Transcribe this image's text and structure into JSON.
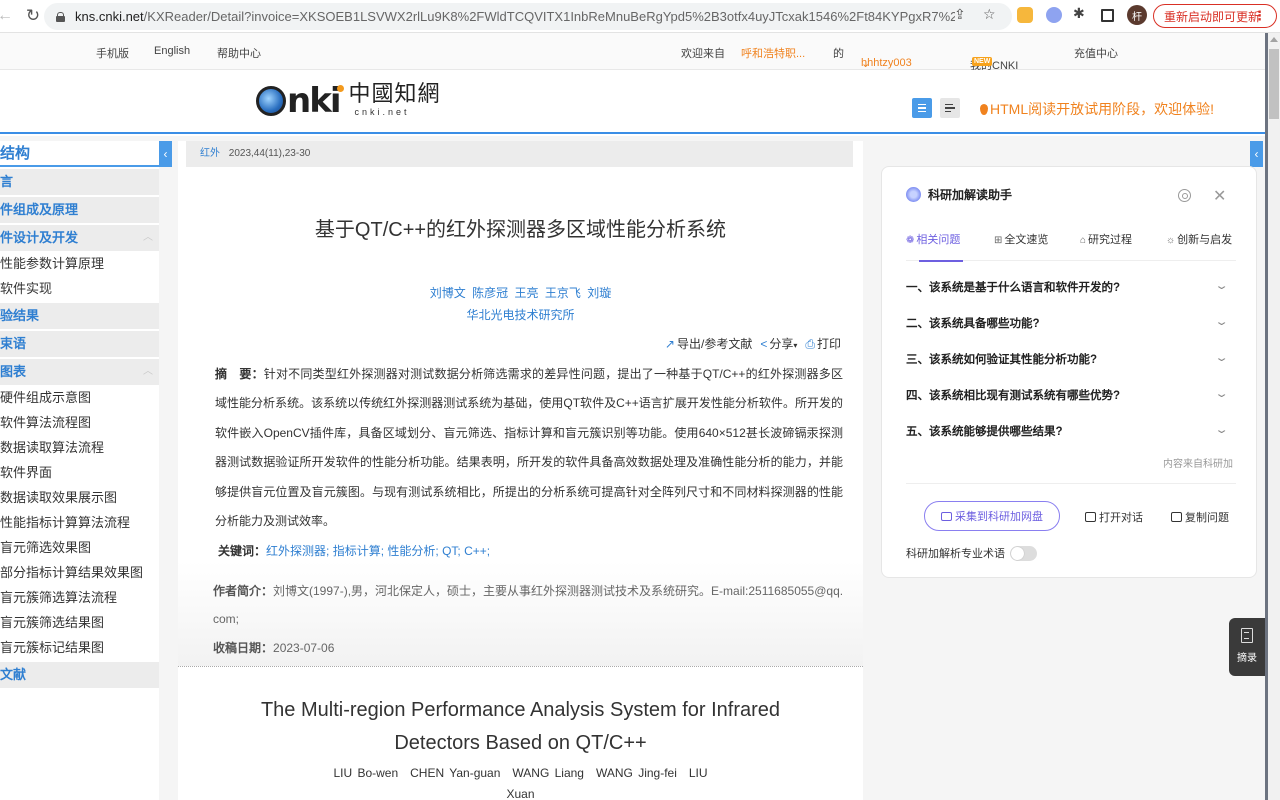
{
  "browser": {
    "url_main": "kns.cnki.net",
    "url_rest": "/KXReader/Detail?invoice=XKSOEB1LSVWX2rlLu9K8%2FWldTCQVITX1InbReMnuBeRgYpd5%2B3otfx4uyJTcxak1546%2Ft84KYPgxR7%2...",
    "avatar_text": "杆",
    "update_button": "重新启动即可更新"
  },
  "topbar": {
    "mobile": "手机版",
    "english": "English",
    "help": "帮助中心",
    "welcome": "欢迎来自",
    "institution": "呼和浩特职...",
    "of": "的",
    "username": "hhhtzy003",
    "my_cnki": "我的CNKI",
    "new_badge": "NEW",
    "recharge": "充值中心"
  },
  "header": {
    "logo_cn": "中國知網",
    "logo_en": "cnki.net",
    "logo_mark": "nki",
    "notice": "HTML阅读开放试用阶段，欢迎体验!"
  },
  "toc": {
    "title": "结构",
    "items": [
      {
        "label": "言",
        "level": 1
      },
      {
        "label": "件组成及原理",
        "level": 1
      },
      {
        "label": "件设计及开发",
        "level": 1,
        "expanded": true
      },
      {
        "label": "性能参数计算原理",
        "level": 2
      },
      {
        "label": "软件实现",
        "level": 2
      },
      {
        "label": "验结果",
        "level": 1
      },
      {
        "label": "束语",
        "level": 1
      },
      {
        "label": "图表",
        "level": 1,
        "expanded": true
      },
      {
        "label": "硬件组成示意图",
        "level": 2
      },
      {
        "label": "软件算法流程图",
        "level": 2
      },
      {
        "label": "数据读取算法流程",
        "level": 2
      },
      {
        "label": "软件界面",
        "level": 2
      },
      {
        "label": "数据读取效果展示图",
        "level": 2
      },
      {
        "label": "性能指标计算算法流程",
        "level": 2
      },
      {
        "label": "盲元筛选效果图",
        "level": 2
      },
      {
        "label": "部分指标计算结果效果图",
        "level": 2
      },
      {
        "label": "盲元簇筛选算法流程",
        "level": 2
      },
      {
        "label": "盲元簇筛选结果图",
        "level": 2
      },
      {
        "label": "盲元簇标记结果图",
        "level": 2
      },
      {
        "label": "文献",
        "level": 1
      }
    ]
  },
  "article": {
    "journal": "红外",
    "issue": "2023,44(11),23-30",
    "title_cn": "基于QT/C++的红外探测器多区域性能分析系统",
    "authors": [
      "刘博文",
      "陈彦冠",
      "王亮",
      "王京飞",
      "刘璇"
    ],
    "affiliation": "华北光电技术研究所",
    "tools": {
      "export": "导出/参考文献",
      "share": "分享",
      "print": "打印"
    },
    "abstract_label": "摘　要：",
    "abstract": "针对不同类型红外探测器对测试数据分析筛选需求的差异性问题，提出了一种基于QT/C++的红外探测器多区域性能分析系统。该系统以传统红外探测器测试系统为基础，使用QT软件及C++语言扩展开发性能分析软件。所开发的软件嵌入OpenCV插件库，具备区域划分、盲元筛选、指标计算和盲元簇识别等功能。使用640×512甚长波碲镉汞探测器测试数据验证所开发软件的性能分析功能。结果表明，所开发的软件具备高效数据处理及准确性能分析的能力，并能够提供盲元位置及盲元簇图。与现有测试系统相比，所提出的分析系统可提高针对全阵列尺寸和不同材料探测器的性能分析能力及测试效率。",
    "keywords_label": "关键词：",
    "keywords": [
      "红外探测器",
      "指标计算",
      "性能分析",
      "QT",
      "C++"
    ],
    "bio_label": "作者简介：",
    "bio": "刘博文(1997-),男，河北保定人，硕士，主要从事红外探测器测试技术及系统研究。E-mail:2511685055@qq.com;",
    "received_label": "收稿日期：",
    "received": "2023-07-06",
    "title_en": "The Multi-region Performance Analysis System for Infrared Detectors Based on QT/C++",
    "authors_en": "LIU Bo-wen　CHEN Yan-guan　WANG Liang　WANG Jing-fei　LIU Xuan"
  },
  "assistant": {
    "title": "科研加解读助手",
    "tabs": [
      {
        "label": "相关问题",
        "icon": "❁",
        "active": true
      },
      {
        "label": "全文速览",
        "icon": "⊞"
      },
      {
        "label": "研究过程",
        "icon": "⌂"
      },
      {
        "label": "创新与启发",
        "icon": "☼"
      }
    ],
    "questions": [
      "一、该系统是基于什么语言和软件开发的?",
      "二、该系统具备哪些功能?",
      "三、该系统如何验证其性能分析功能?",
      "四、该系统相比现有测试系统有哪些优势?",
      "五、该系统能够提供哪些结果?"
    ],
    "source": "内容来自科研加",
    "collect_button": "采集到科研加网盘",
    "open_chat": "打开对话",
    "copy_question": "复制问题",
    "toggle_label": "科研加解析专业术语",
    "toggle_on": false
  },
  "excerpt": {
    "label": "摘录"
  },
  "colors": {
    "accent_blue": "#2f7fd1",
    "orange": "#f0821e",
    "purple": "#6d5fe0"
  }
}
